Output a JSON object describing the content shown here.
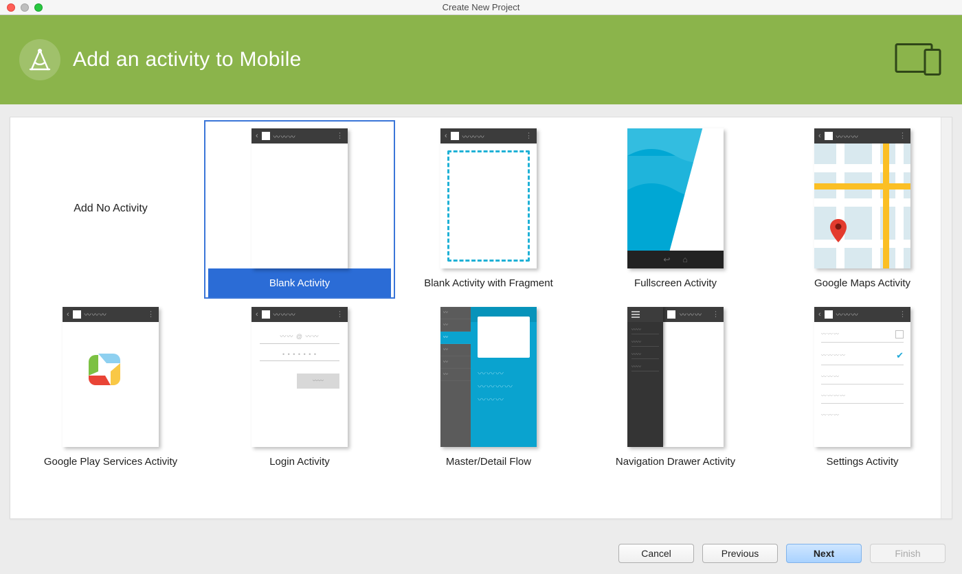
{
  "window": {
    "title": "Create New Project"
  },
  "header": {
    "heading": "Add an activity to Mobile"
  },
  "activities": [
    {
      "label": "Add No Activity",
      "variant": "none",
      "selected": false
    },
    {
      "label": "Blank Activity",
      "variant": "blank",
      "selected": true
    },
    {
      "label": "Blank Activity with Fragment",
      "variant": "fragment",
      "selected": false
    },
    {
      "label": "Fullscreen Activity",
      "variant": "fullscreen",
      "selected": false
    },
    {
      "label": "Google Maps Activity",
      "variant": "maps",
      "selected": false
    },
    {
      "label": "Google Play Services Activity",
      "variant": "play",
      "selected": false
    },
    {
      "label": "Login Activity",
      "variant": "login",
      "selected": false
    },
    {
      "label": "Master/Detail Flow",
      "variant": "masterdetail",
      "selected": false
    },
    {
      "label": "Navigation Drawer Activity",
      "variant": "navdrawer",
      "selected": false
    },
    {
      "label": "Settings Activity",
      "variant": "settings",
      "selected": false
    }
  ],
  "footer": {
    "cancel": "Cancel",
    "previous": "Previous",
    "next": "Next",
    "finish": "Finish"
  }
}
